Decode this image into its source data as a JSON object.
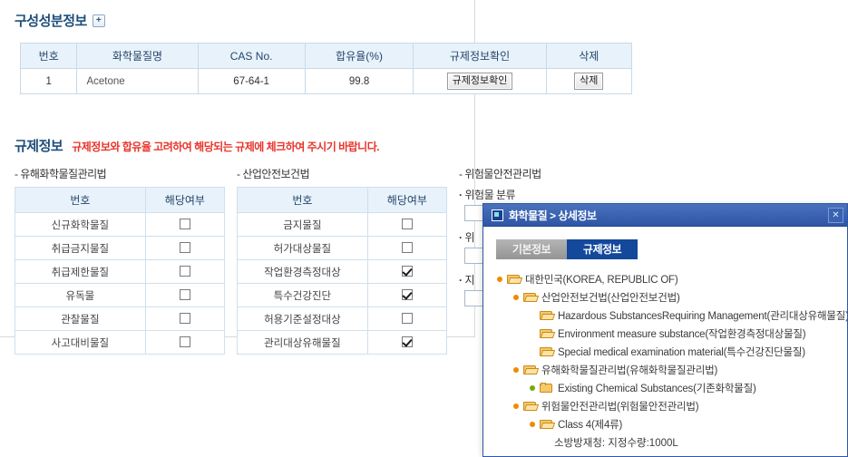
{
  "page": {
    "composition_section": {
      "title": "구성성분정보",
      "add_button_label": "+"
    },
    "composition_table": {
      "headers": [
        "번호",
        "화학물질명",
        "CAS No.",
        "합유율(%)",
        "규제정보확인",
        "삭제"
      ],
      "rows": [
        {
          "no": "1",
          "name": "Acetone",
          "cas": "67-64-1",
          "ratio": "99.8",
          "reg_button": "규제정보확인",
          "delete_button": "삭제"
        }
      ]
    },
    "regulation_section": {
      "title": "규제정보",
      "note": "규제정보와 합유율 고려하여 해당되는 규제에 체크하여 주시기 바랍니다."
    },
    "law_columns": [
      {
        "label": "- 유해화학물질관리법",
        "headers": [
          "번호",
          "해당여부"
        ],
        "rows": [
          {
            "name": "신규화학물질",
            "checked": false
          },
          {
            "name": "취급금지물질",
            "checked": false
          },
          {
            "name": "취급제한물질",
            "checked": false
          },
          {
            "name": "유독물",
            "checked": false
          },
          {
            "name": "관찰물질",
            "checked": false
          },
          {
            "name": "사고대비물질",
            "checked": false
          }
        ]
      },
      {
        "label": "- 산업안전보건법",
        "headers": [
          "번호",
          "해당여부"
        ],
        "rows": [
          {
            "name": "금지물질",
            "checked": false
          },
          {
            "name": "허가대상물질",
            "checked": false
          },
          {
            "name": "작업환경측정대상",
            "checked": true
          },
          {
            "name": "특수건강진단",
            "checked": true
          },
          {
            "name": "허용기준설정대상",
            "checked": false
          },
          {
            "name": "관리대상유해물질",
            "checked": true
          }
        ]
      }
    ],
    "dangerous_goods_column": {
      "label": "- 위험물안전관리법",
      "items": [
        {
          "label": "위험물 분류",
          "value": ""
        },
        {
          "label": "위",
          "value": ""
        },
        {
          "label": "지",
          "value": ""
        }
      ]
    }
  },
  "dialog": {
    "title": "화학물질 > 상세정보",
    "close_label": "✕",
    "tabs": [
      {
        "label": "기본정보",
        "active": false
      },
      {
        "label": "규제정보",
        "active": true
      }
    ],
    "tree": [
      {
        "label": "대한민국(KOREA, REPUBLIC OF)",
        "depth": 0,
        "toggle": "orange",
        "folder": "open"
      },
      {
        "label": "산업안전보건법(산업안전보건법)",
        "depth": 1,
        "toggle": "orange",
        "folder": "open"
      },
      {
        "label": "Hazardous SubstancesRequiring Management(관리대상유해물질)",
        "depth": 2,
        "toggle": "none",
        "folder": "open"
      },
      {
        "label": "Environment measure substance(작업환경측정대상물질)",
        "depth": 2,
        "toggle": "none",
        "folder": "open"
      },
      {
        "label": "Special medical examination material(특수건강진단물질)",
        "depth": 2,
        "toggle": "none",
        "folder": "open"
      },
      {
        "label": "유해화학물질관리법(유해화학물질관리법)",
        "depth": 1,
        "toggle": "orange",
        "folder": "open"
      },
      {
        "label": "Existing Chemical Substances(기존화학물질)",
        "depth": 2,
        "toggle": "green",
        "folder": "closed"
      },
      {
        "label": "위험물안전관리법(위험물안전관리법)",
        "depth": 1,
        "toggle": "orange",
        "folder": "open"
      },
      {
        "label": "Class 4(제4류)",
        "depth": 2,
        "toggle": "orange",
        "folder": "open"
      },
      {
        "label": "소방방재청: 지정수량:1000L",
        "depth": 3,
        "toggle": "plain",
        "folder": "none"
      }
    ]
  },
  "colors": {
    "heading": "#1f4e79",
    "note_red": "#e8342a",
    "table_header_bg": "#e8f2fa",
    "dialog_blue": "#2e56a6",
    "tab_active": "#13489b",
    "folder_yellow": "#f6c96a"
  }
}
